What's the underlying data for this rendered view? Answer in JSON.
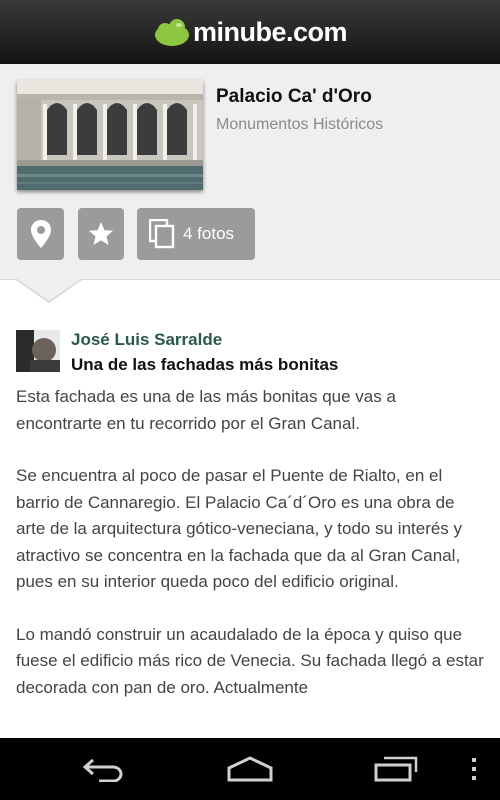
{
  "app": {
    "logo_text": "minube.com"
  },
  "place": {
    "title": "Palacio Ca' d'Oro",
    "category": "Monumentos Históricos"
  },
  "actions": {
    "photos_label": "4 fotos"
  },
  "review": {
    "author": "José Luis Sarralde",
    "title": "Una de las fachadas más bonitas",
    "paragraphs": [
      "Esta fachada es una de las más bonitas que vas a encontrarte en tu recorrido por el Gran Canal.",
      "Se encuentra al poco de pasar el Puente de Rialto, en el barrio de Cannaregio. El Palacio Ca´d´Oro es una obra de arte de la arquitectura gótico-veneciana, y todo su interés y atractivo se concentra en la fachada que da al Gran Canal, pues en su interior queda poco del edificio original.",
      "Lo mandó construir un acaudalado de la época y quiso que fuese el edificio más rico de Venecia. Su fachada llegó a estar decorada con pan de oro. Actualmente"
    ]
  },
  "colors": {
    "brand_green": "#8dc63f",
    "author_color": "#2a5a46",
    "button_gray": "#9b9b9b"
  },
  "icons": {
    "map": "map-pin-icon",
    "favorite": "star-icon",
    "photos": "photos-icon",
    "back": "back-icon",
    "home": "home-icon",
    "recents": "recent-apps-icon",
    "menu": "overflow-menu-icon"
  }
}
